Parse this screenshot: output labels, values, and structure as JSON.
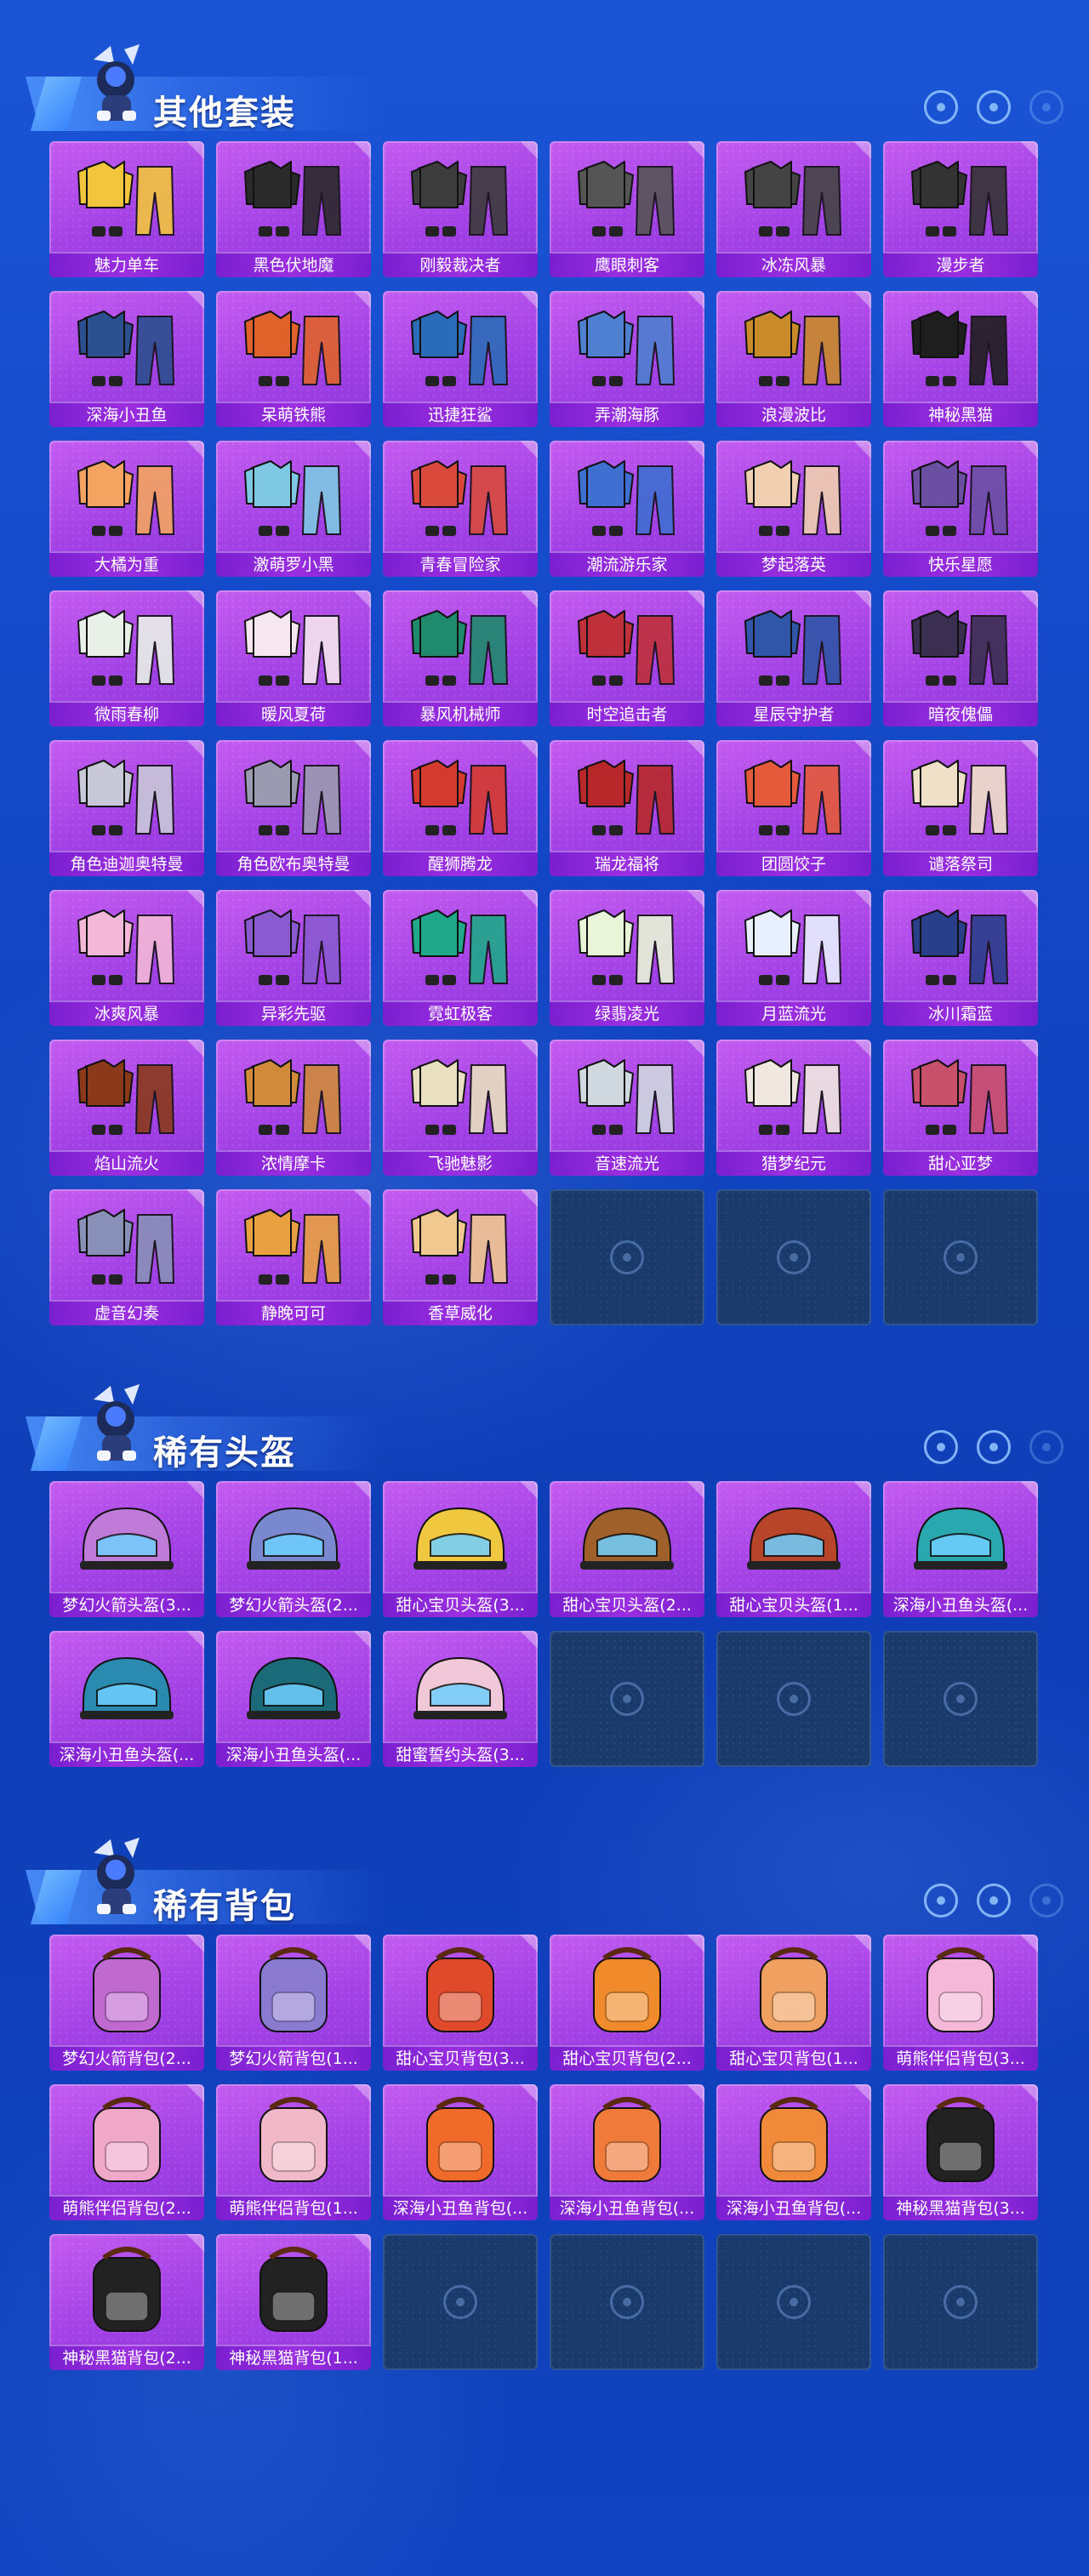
{
  "sections": [
    {
      "title": "其他套装",
      "kind": "outfit",
      "items": [
        "魅力单车",
        "黑色伏地魔",
        "刚毅裁决者",
        "鹰眼刺客",
        "冰冻风暴",
        "漫步者",
        "深海小丑鱼",
        "呆萌铁熊",
        "迅捷狂鲨",
        "弄潮海豚",
        "浪漫波比",
        "神秘黑猫",
        "大橘为重",
        "激萌罗小黑",
        "青春冒险家",
        "潮流游乐家",
        "梦起落英",
        "快乐星愿",
        "微雨春柳",
        "暖风夏荷",
        "暴风机械师",
        "时空追击者",
        "星辰守护者",
        "暗夜傀儡",
        "角色迪迦奥特曼",
        "角色欧布奥特曼",
        "醒狮腾龙",
        "瑞龙福将",
        "团圆饺子",
        "谴落祭司",
        "冰爽风暴",
        "异彩先驱",
        "霓虹极客",
        "绿翡凌光",
        "月蓝流光",
        "冰川霜蓝",
        "焰山流火",
        "浓情摩卡",
        "飞驰魅影",
        "音速流光",
        "猎梦纪元",
        "甜心亚梦",
        "虚音幻奏",
        "静晚可可",
        "香草威化"
      ],
      "empty_slots": 3
    },
    {
      "title": "稀有头盔",
      "kind": "helmet",
      "items": [
        "梦幻火箭头盔(3...",
        "梦幻火箭头盔(2...",
        "甜心宝贝头盔(3...",
        "甜心宝贝头盔(2...",
        "甜心宝贝头盔(1...",
        "深海小丑鱼头盔(...",
        "深海小丑鱼头盔(...",
        "深海小丑鱼头盔(...",
        "甜蜜誓约头盔(3..."
      ],
      "empty_slots": 3
    },
    {
      "title": "稀有背包",
      "kind": "backpack",
      "items": [
        "梦幻火箭背包(2...",
        "梦幻火箭背包(1...",
        "甜心宝贝背包(3...",
        "甜心宝贝背包(2...",
        "甜心宝贝背包(1...",
        "萌熊伴侣背包(3...",
        "萌熊伴侣背包(2...",
        "萌熊伴侣背包(1...",
        "深海小丑鱼背包(...",
        "深海小丑鱼背包(...",
        "深海小丑鱼背包(...",
        "神秘黑猫背包(3...",
        "神秘黑猫背包(2...",
        "神秘黑猫背包(1..."
      ],
      "empty_slots": 4
    }
  ],
  "colors": {
    "card": "#a442e6",
    "label_bar": "#8a26d8",
    "empty_slot": "#1a3a6c",
    "page_bg": "#1246c4"
  }
}
